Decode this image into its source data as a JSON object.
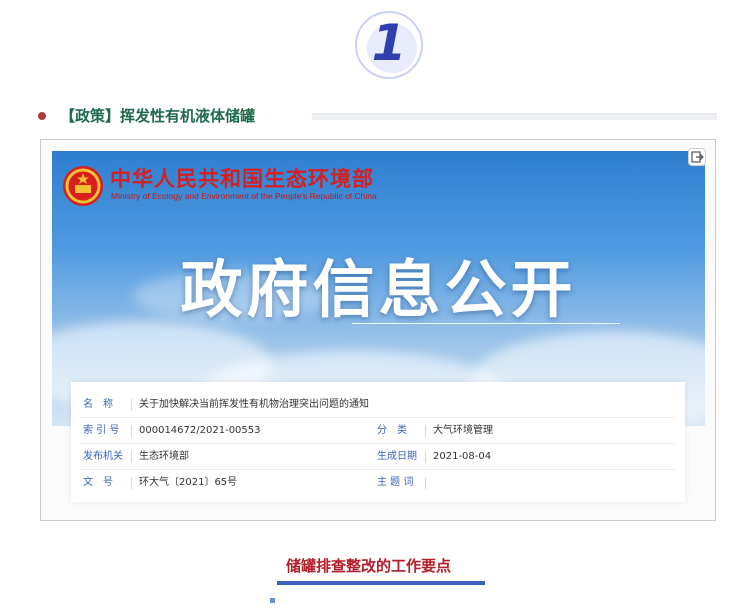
{
  "badge": {
    "number": "1"
  },
  "section": {
    "title": "【政策】挥发性有机液体储罐"
  },
  "ministry": {
    "name_cn": "中华人民共和国生态环境部",
    "name_en": "Ministry of Ecology and Environment of the People's Republic of China"
  },
  "hero": {
    "title": "政府信息公开"
  },
  "info": {
    "name_label": "名　称",
    "name_value": "关于加快解决当前挥发性有机物治理突出问题的通知",
    "index_label": "索 引 号",
    "index_value": "000014672/2021-00553",
    "category_label": "分　类",
    "category_value": "大气环境管理",
    "issuer_label": "发布机关",
    "issuer_value": "生态环境部",
    "date_label": "生成日期",
    "date_value": "2021-08-04",
    "docno_label": "文　号",
    "docno_value": "环大气〔2021〕65号",
    "subject_label": "主 题 词",
    "subject_value": ""
  },
  "subsection": {
    "title": "储罐排查整改的工作要点"
  },
  "colors": {
    "accent_blue": "#2f3fae",
    "section_green": "#1e6b4a",
    "ministry_red": "#d81e1e",
    "label_blue": "#3a64b8",
    "sub_red": "#b11f2a"
  },
  "icons": [
    "national-emblem-icon",
    "export-icon"
  ]
}
